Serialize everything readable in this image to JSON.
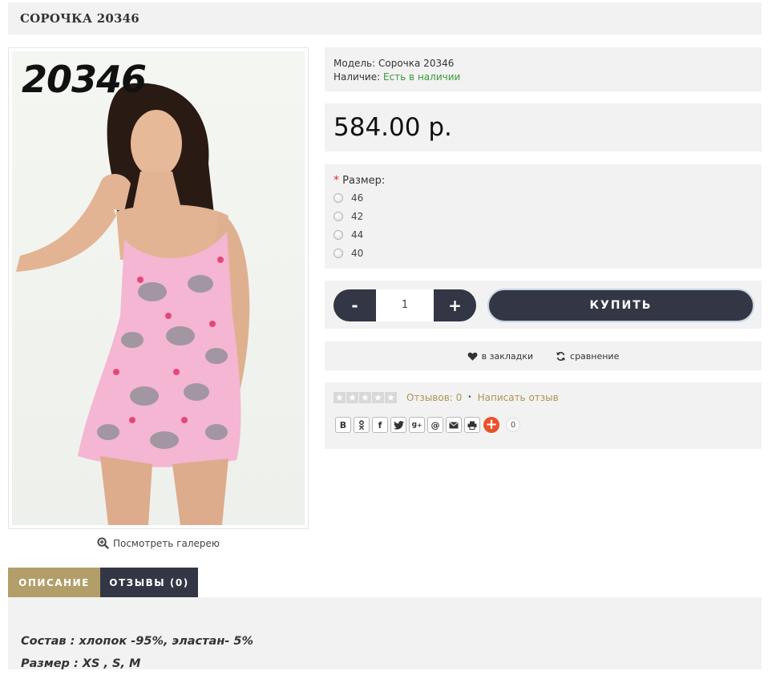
{
  "product": {
    "title": "СОРОЧКА 20346",
    "image_number": "20346",
    "gallery_link": "Посмотреть галерею"
  },
  "info": {
    "model_label": "Модель:",
    "model_value": "Сорочка 20346",
    "availability_label": "Наличие:",
    "availability_value": "Есть в наличии"
  },
  "price": "584.00 р.",
  "options": {
    "required_mark": "*",
    "size_label": "Размер:",
    "sizes": [
      "46",
      "42",
      "44",
      "40"
    ]
  },
  "cart": {
    "minus": "-",
    "quantity": "1",
    "plus": "+",
    "buy_label": "КУПИТЬ"
  },
  "actions": {
    "wishlist": "в закладки",
    "compare": "сравнение"
  },
  "reviews": {
    "reviews_count": "Отзывов: 0",
    "write_review": "Написать отзыв",
    "separator": "•"
  },
  "share": {
    "buttons": [
      "B",
      "ok",
      "f",
      "tw",
      "g+",
      "@",
      "mail",
      "print"
    ],
    "count": "0"
  },
  "tabs": {
    "description": "ОПИСАНИЕ",
    "reviews": "ОТЗЫВЫ (0)"
  },
  "description": {
    "line1": "Состав : хлопок -95%, эластан- 5%",
    "line2": "Размер : XS , S, M"
  },
  "colors": {
    "dark": "#333645",
    "gold": "#b29e68",
    "green": "#3a9a3a",
    "panel": "#f2f2f2"
  }
}
